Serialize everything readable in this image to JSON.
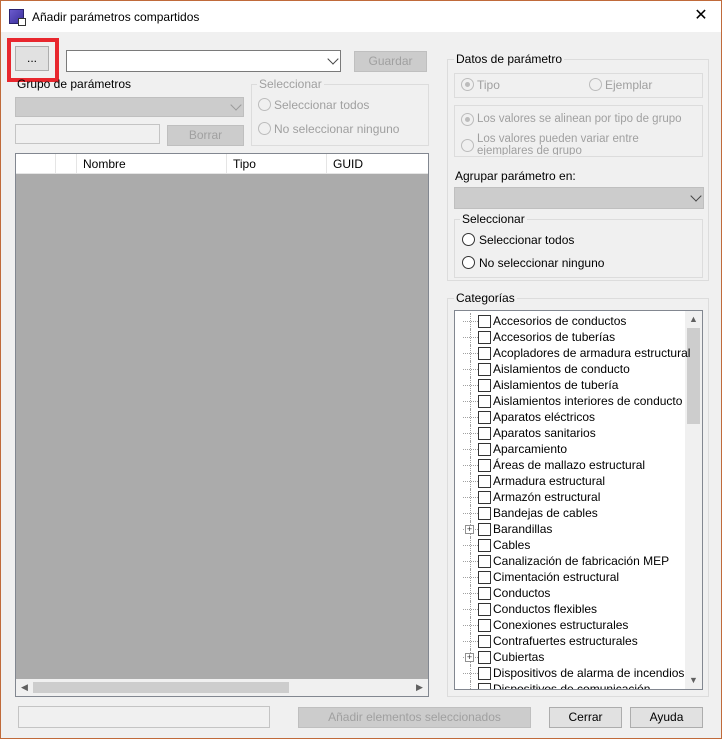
{
  "window": {
    "title": "Añadir parámetros compartidos",
    "close_glyph": "✕"
  },
  "toolbar": {
    "browse_label": "...",
    "file_value": "",
    "save_label": "Guardar"
  },
  "param_group": {
    "label": "Grupo de parámetros",
    "value": "",
    "new_value": "",
    "delete_label": "Borrar"
  },
  "select_left": {
    "label": "Seleccionar",
    "select_all": "Seleccionar todos",
    "select_none": "No seleccionar ninguno"
  },
  "grid": {
    "columns": [
      "",
      "",
      "Nombre",
      "Tipo",
      "GUID"
    ]
  },
  "param_data": {
    "label": "Datos de parámetro",
    "type_label": "Tipo",
    "instance_label": "Ejemplar",
    "align_label": "Los valores se alinean por tipo de grupo",
    "vary_label": "Los valores pueden variar entre ejemplares de grupo",
    "group_in_label": "Agrupar parámetro en:",
    "group_in_value": ""
  },
  "select_right": {
    "label": "Seleccionar",
    "select_all": "Seleccionar todos",
    "select_none": "No seleccionar ninguno"
  },
  "categories": {
    "label": "Categorías",
    "items": [
      {
        "label": "Accesorios de conductos",
        "expandable": false
      },
      {
        "label": "Accesorios de tuberías",
        "expandable": false
      },
      {
        "label": "Acopladores de armadura estructural",
        "expandable": false
      },
      {
        "label": "Aislamientos de conducto",
        "expandable": false
      },
      {
        "label": "Aislamientos de tubería",
        "expandable": false
      },
      {
        "label": "Aislamientos interiores de conducto",
        "expandable": false
      },
      {
        "label": "Aparatos eléctricos",
        "expandable": false
      },
      {
        "label": "Aparatos sanitarios",
        "expandable": false
      },
      {
        "label": "Aparcamiento",
        "expandable": false
      },
      {
        "label": "Áreas de mallazo estructural",
        "expandable": false
      },
      {
        "label": "Armadura estructural",
        "expandable": false
      },
      {
        "label": "Armazón estructural",
        "expandable": false
      },
      {
        "label": "Bandejas de cables",
        "expandable": false
      },
      {
        "label": "Barandillas",
        "expandable": true
      },
      {
        "label": "Cables",
        "expandable": false
      },
      {
        "label": "Canalización de fabricación MEP",
        "expandable": false
      },
      {
        "label": "Cimentación estructural",
        "expandable": false
      },
      {
        "label": "Conductos",
        "expandable": false
      },
      {
        "label": "Conductos flexibles",
        "expandable": false
      },
      {
        "label": "Conexiones estructurales",
        "expandable": false
      },
      {
        "label": "Contrafuertes estructurales",
        "expandable": false
      },
      {
        "label": "Cubiertas",
        "expandable": true
      },
      {
        "label": "Dispositivos de alarma de incendios",
        "expandable": false
      },
      {
        "label": "Dispositivos de comunicación",
        "expandable": false
      }
    ]
  },
  "footer": {
    "status_value": "",
    "add_selected_label": "Añadir elementos seleccionados",
    "close_label": "Cerrar",
    "help_label": "Ayuda"
  }
}
